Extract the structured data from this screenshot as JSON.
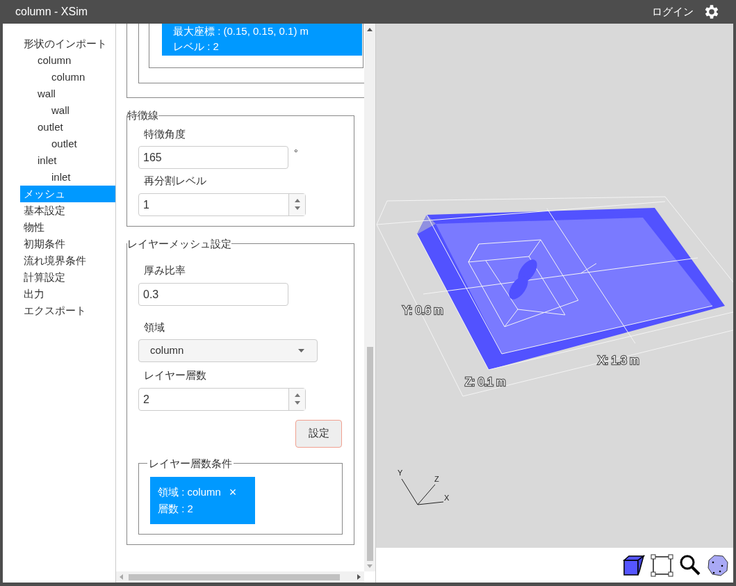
{
  "window": {
    "title": "column - XSim",
    "login": "ログイン"
  },
  "sidebar": {
    "items": [
      {
        "label": "形状のインポート",
        "selected": false,
        "children": [
          {
            "label": "column",
            "selected": false,
            "children": [
              {
                "label": "column",
                "selected": false
              }
            ]
          },
          {
            "label": "wall",
            "selected": false,
            "children": [
              {
                "label": "wall",
                "selected": false
              }
            ]
          },
          {
            "label": "outlet",
            "selected": false,
            "children": [
              {
                "label": "outlet",
                "selected": false
              }
            ]
          },
          {
            "label": "inlet",
            "selected": false,
            "children": [
              {
                "label": "inlet",
                "selected": false
              }
            ]
          }
        ]
      },
      {
        "label": "メッシュ",
        "selected": true
      },
      {
        "label": "基本設定",
        "selected": false
      },
      {
        "label": "物性",
        "selected": false
      },
      {
        "label": "初期条件",
        "selected": false
      },
      {
        "label": "流れ境界条件",
        "selected": false
      },
      {
        "label": "計算設定",
        "selected": false
      },
      {
        "label": "出力",
        "selected": false
      },
      {
        "label": "エクスポート",
        "selected": false
      }
    ]
  },
  "top_card": {
    "lines": [
      "最大座標 : (0.15, 0.15, 0.1) m",
      "レベル : 2"
    ]
  },
  "feature_lines": {
    "legend": "特徴線",
    "angle": {
      "label": "特徴角度",
      "value": "165",
      "unit": "°"
    },
    "refine": {
      "label": "再分割レベル",
      "value": "1"
    }
  },
  "layer_mesh": {
    "legend": "レイヤーメッシュ設定",
    "thickness": {
      "label": "厚み比率",
      "value": "0.3"
    },
    "region": {
      "label": "領域",
      "value": "column"
    },
    "layers": {
      "label": "レイヤー層数",
      "value": "2"
    },
    "set_button": "設定",
    "conditions": {
      "legend": "レイヤー層数条件",
      "items": [
        {
          "region": "領域 : column",
          "count": "層数 : 2",
          "remove": "×"
        }
      ]
    }
  },
  "viewport": {
    "dims": {
      "y": "Y: 0.6 m",
      "x": "X: 1.3 m",
      "z": "Z: 0.1 m"
    },
    "axes": {
      "y": "Y",
      "z": "Z",
      "x": "X"
    }
  }
}
